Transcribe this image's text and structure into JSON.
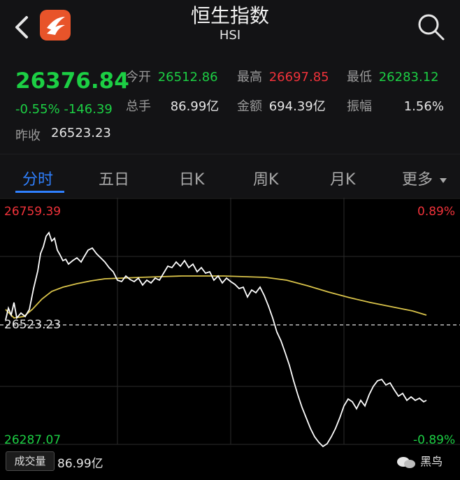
{
  "header": {
    "title": "恒生指数",
    "subtitle": "HSI"
  },
  "quote": {
    "price": "26376.84",
    "change": "-0.55%  -146.39",
    "prev_close_label": "昨收",
    "prev_close": "26523.23",
    "stats": [
      {
        "label": "今开",
        "value": "26512.86",
        "color": "green"
      },
      {
        "label": "最高",
        "value": "26697.85",
        "color": "red"
      },
      {
        "label": "最低",
        "value": "26283.12",
        "color": "green"
      },
      {
        "label": "总手",
        "value": "86.99亿",
        "color": "white"
      },
      {
        "label": "金额",
        "value": "694.39亿",
        "color": "white"
      },
      {
        "label": "振幅",
        "value": "1.56%",
        "color": "white"
      }
    ]
  },
  "tabs": [
    "分时",
    "五日",
    "日K",
    "周K",
    "月K",
    "更多"
  ],
  "chart": {
    "top_price": "26759.39",
    "top_pct": "0.89%",
    "mid_price": "26523.23",
    "bottom_price": "26287.07",
    "bottom_pct": "-0.89%",
    "volume_label": "成交量",
    "volume_value": "86.99亿"
  },
  "watermark": "黑鸟",
  "colors": {
    "up": "#f0323a",
    "down": "#1ccf44",
    "accent": "#2f80ff",
    "price_line": "#ffffff",
    "avg_line": "#d9c34a"
  }
}
